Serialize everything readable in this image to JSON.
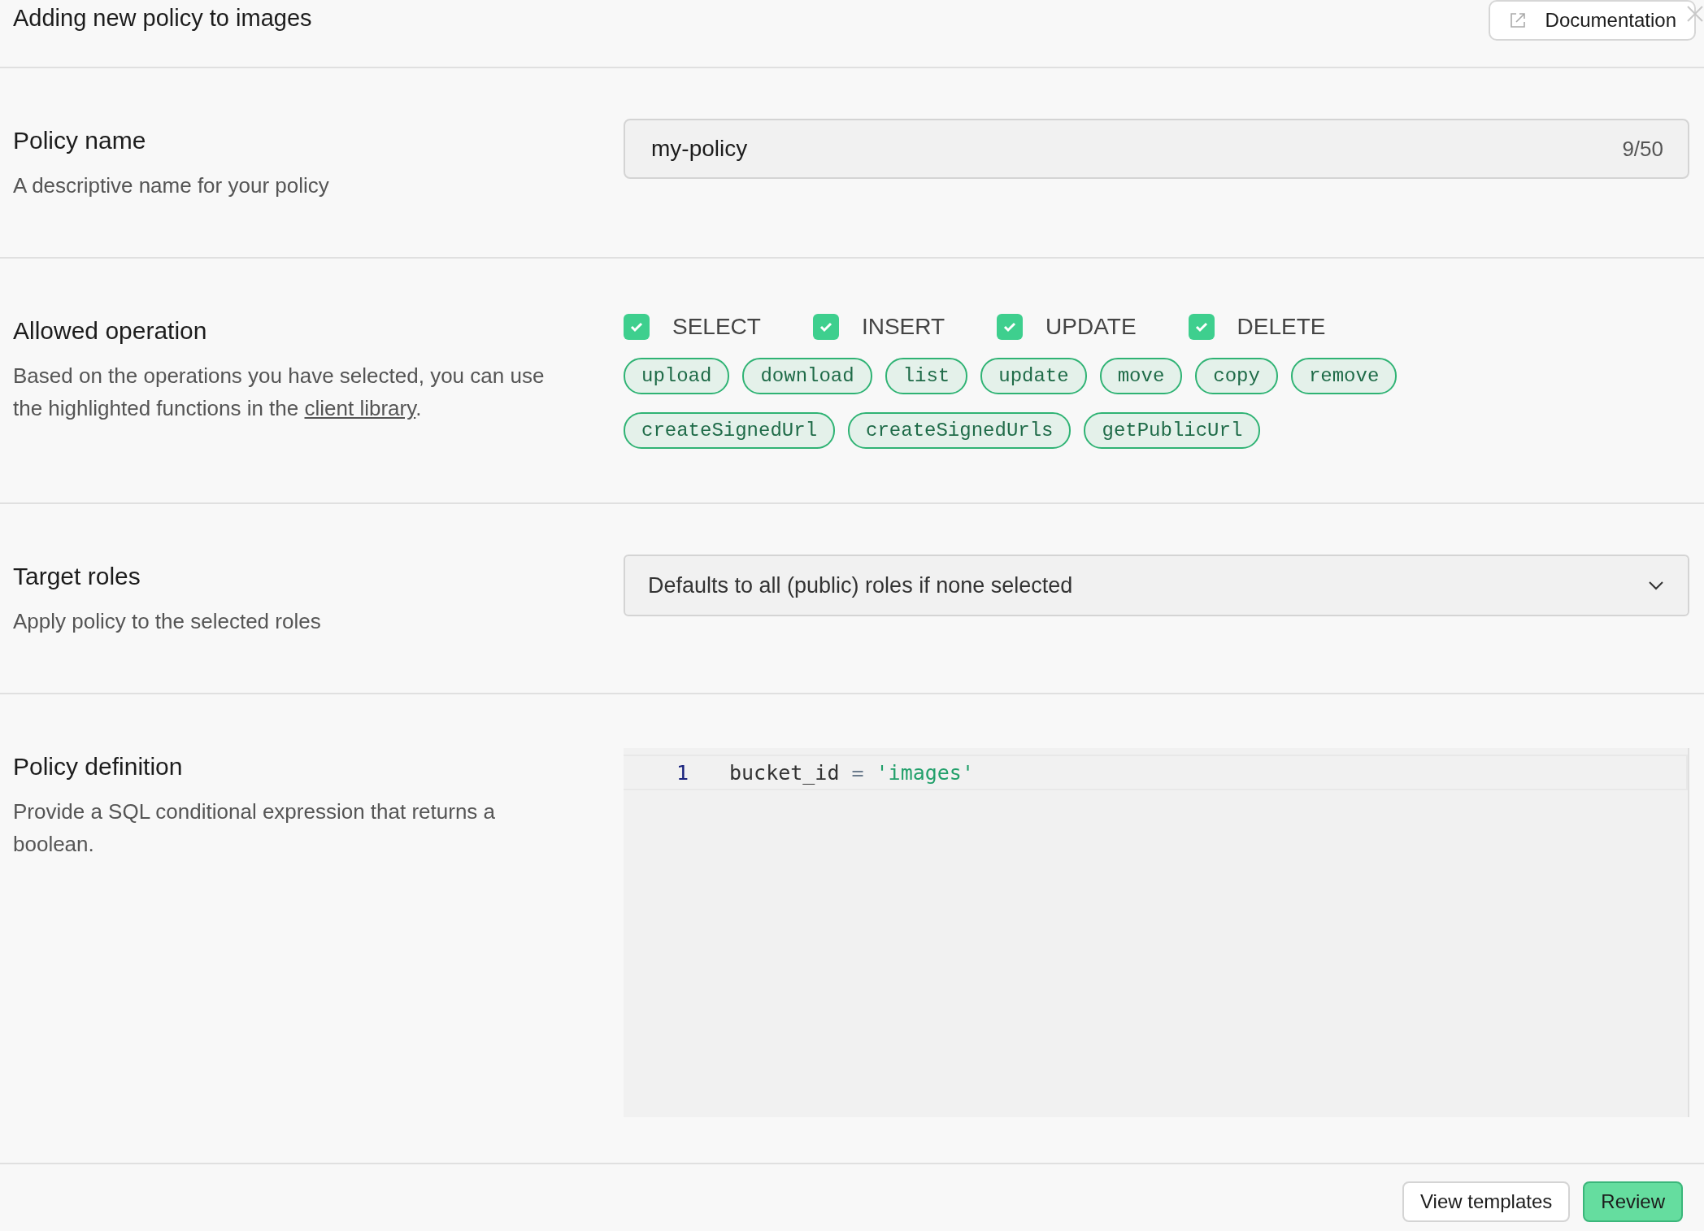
{
  "header": {
    "title": "Adding new policy to images",
    "documentation_button": "Documentation"
  },
  "policy_name": {
    "label": "Policy name",
    "description": "A descriptive name for your policy",
    "value": "my-policy",
    "counter": "9/50"
  },
  "allowed_operation": {
    "label": "Allowed operation",
    "description_before": "Based on the operations you have selected, you can use the highlighted functions in the ",
    "description_link": "client library",
    "description_after": ".",
    "operations": [
      {
        "label": "SELECT",
        "checked": true
      },
      {
        "label": "INSERT",
        "checked": true
      },
      {
        "label": "UPDATE",
        "checked": true
      },
      {
        "label": "DELETE",
        "checked": true
      }
    ],
    "functions": [
      [
        "upload",
        "download",
        "list",
        "update",
        "move",
        "copy",
        "remove"
      ],
      [
        "createSignedUrl",
        "createSignedUrls",
        "getPublicUrl"
      ]
    ]
  },
  "target_roles": {
    "label": "Target roles",
    "description": "Apply policy to the selected roles",
    "placeholder": "Defaults to all (public) roles if none selected"
  },
  "policy_definition": {
    "label": "Policy definition",
    "description": "Provide a SQL conditional expression that returns a boolean.",
    "lines": [
      {
        "number": "1",
        "tokens": [
          {
            "kind": "identifier",
            "text": "bucket_id"
          },
          {
            "kind": "operator",
            "text": "="
          },
          {
            "kind": "string",
            "text": "'images'"
          }
        ]
      }
    ]
  },
  "footer": {
    "buttons": [
      {
        "label": "View templates",
        "kind": "secondary"
      },
      {
        "label": "Review",
        "kind": "primary"
      }
    ]
  }
}
